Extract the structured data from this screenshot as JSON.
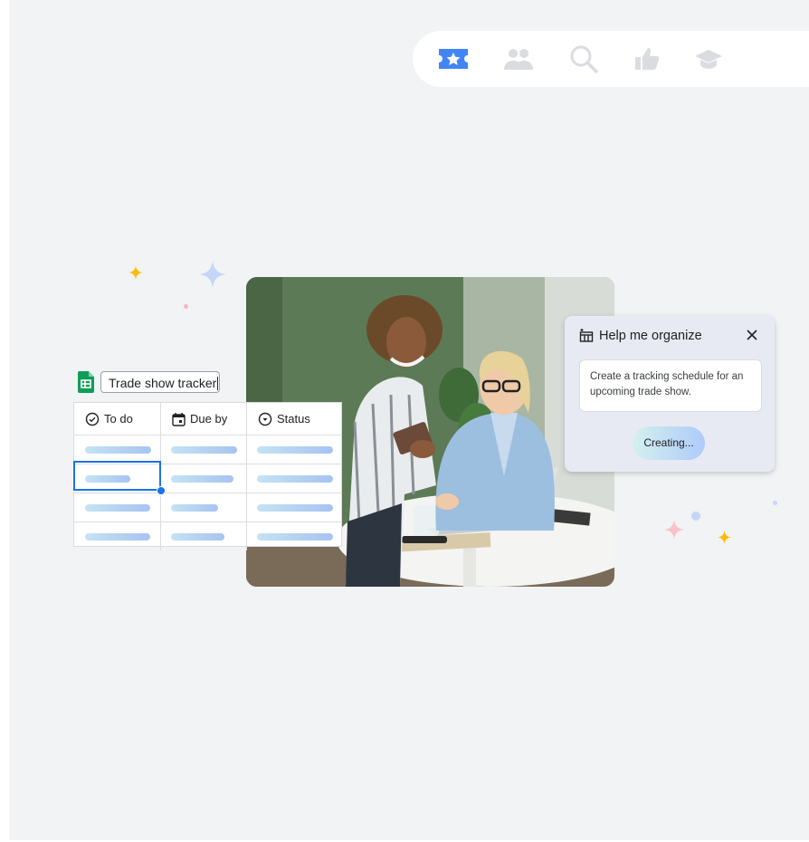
{
  "nav_icons": [
    {
      "name": "featured-icon",
      "color": "#4285f4"
    },
    {
      "name": "people-icon",
      "color": "#dadce0"
    },
    {
      "name": "search-icon",
      "color": "#dadce0"
    },
    {
      "name": "thumbs-up-icon",
      "color": "#dadce0"
    },
    {
      "name": "graduation-cap-icon",
      "color": "#dadce0"
    }
  ],
  "sheet": {
    "title": "Trade show tracker",
    "columns": [
      {
        "label": "To do",
        "icon": "check-circle-icon"
      },
      {
        "label": "Due by",
        "icon": "calendar-icon"
      },
      {
        "label": "Status",
        "icon": "dropdown-circle-icon"
      }
    ]
  },
  "help_panel": {
    "title": "Help me organize",
    "prompt": "Create a tracking schedule for an upcoming trade show.",
    "button_label": "Creating..."
  },
  "colors": {
    "accent": "#1a73e8",
    "sheets_green": "#0f9d58",
    "sparkle_yellow": "#fbbc04"
  }
}
